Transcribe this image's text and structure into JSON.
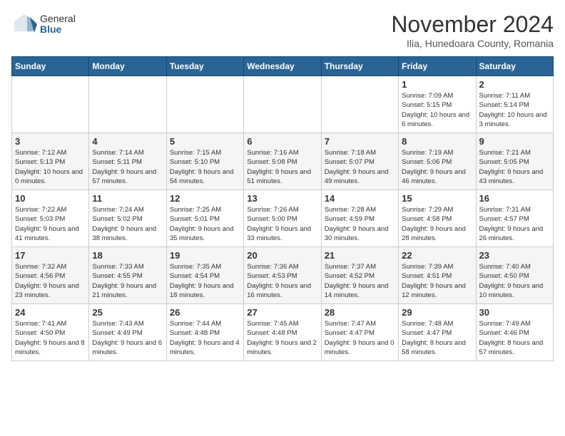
{
  "logo": {
    "general": "General",
    "blue": "Blue"
  },
  "title": "November 2024",
  "subtitle": "Ilia, Hunedoara County, Romania",
  "headers": [
    "Sunday",
    "Monday",
    "Tuesday",
    "Wednesday",
    "Thursday",
    "Friday",
    "Saturday"
  ],
  "weeks": [
    [
      {
        "day": "",
        "info": ""
      },
      {
        "day": "",
        "info": ""
      },
      {
        "day": "",
        "info": ""
      },
      {
        "day": "",
        "info": ""
      },
      {
        "day": "",
        "info": ""
      },
      {
        "day": "1",
        "info": "Sunrise: 7:09 AM\nSunset: 5:15 PM\nDaylight: 10 hours and 6 minutes."
      },
      {
        "day": "2",
        "info": "Sunrise: 7:11 AM\nSunset: 5:14 PM\nDaylight: 10 hours and 3 minutes."
      }
    ],
    [
      {
        "day": "3",
        "info": "Sunrise: 7:12 AM\nSunset: 5:13 PM\nDaylight: 10 hours and 0 minutes."
      },
      {
        "day": "4",
        "info": "Sunrise: 7:14 AM\nSunset: 5:11 PM\nDaylight: 9 hours and 57 minutes."
      },
      {
        "day": "5",
        "info": "Sunrise: 7:15 AM\nSunset: 5:10 PM\nDaylight: 9 hours and 54 minutes."
      },
      {
        "day": "6",
        "info": "Sunrise: 7:16 AM\nSunset: 5:08 PM\nDaylight: 9 hours and 51 minutes."
      },
      {
        "day": "7",
        "info": "Sunrise: 7:18 AM\nSunset: 5:07 PM\nDaylight: 9 hours and 49 minutes."
      },
      {
        "day": "8",
        "info": "Sunrise: 7:19 AM\nSunset: 5:06 PM\nDaylight: 9 hours and 46 minutes."
      },
      {
        "day": "9",
        "info": "Sunrise: 7:21 AM\nSunset: 5:05 PM\nDaylight: 9 hours and 43 minutes."
      }
    ],
    [
      {
        "day": "10",
        "info": "Sunrise: 7:22 AM\nSunset: 5:03 PM\nDaylight: 9 hours and 41 minutes."
      },
      {
        "day": "11",
        "info": "Sunrise: 7:24 AM\nSunset: 5:02 PM\nDaylight: 9 hours and 38 minutes."
      },
      {
        "day": "12",
        "info": "Sunrise: 7:25 AM\nSunset: 5:01 PM\nDaylight: 9 hours and 35 minutes."
      },
      {
        "day": "13",
        "info": "Sunrise: 7:26 AM\nSunset: 5:00 PM\nDaylight: 9 hours and 33 minutes."
      },
      {
        "day": "14",
        "info": "Sunrise: 7:28 AM\nSunset: 4:59 PM\nDaylight: 9 hours and 30 minutes."
      },
      {
        "day": "15",
        "info": "Sunrise: 7:29 AM\nSunset: 4:58 PM\nDaylight: 9 hours and 28 minutes."
      },
      {
        "day": "16",
        "info": "Sunrise: 7:31 AM\nSunset: 4:57 PM\nDaylight: 9 hours and 26 minutes."
      }
    ],
    [
      {
        "day": "17",
        "info": "Sunrise: 7:32 AM\nSunset: 4:56 PM\nDaylight: 9 hours and 23 minutes."
      },
      {
        "day": "18",
        "info": "Sunrise: 7:33 AM\nSunset: 4:55 PM\nDaylight: 9 hours and 21 minutes."
      },
      {
        "day": "19",
        "info": "Sunrise: 7:35 AM\nSunset: 4:54 PM\nDaylight: 9 hours and 18 minutes."
      },
      {
        "day": "20",
        "info": "Sunrise: 7:36 AM\nSunset: 4:53 PM\nDaylight: 9 hours and 16 minutes."
      },
      {
        "day": "21",
        "info": "Sunrise: 7:37 AM\nSunset: 4:52 PM\nDaylight: 9 hours and 14 minutes."
      },
      {
        "day": "22",
        "info": "Sunrise: 7:39 AM\nSunset: 4:51 PM\nDaylight: 9 hours and 12 minutes."
      },
      {
        "day": "23",
        "info": "Sunrise: 7:40 AM\nSunset: 4:50 PM\nDaylight: 9 hours and 10 minutes."
      }
    ],
    [
      {
        "day": "24",
        "info": "Sunrise: 7:41 AM\nSunset: 4:50 PM\nDaylight: 9 hours and 8 minutes."
      },
      {
        "day": "25",
        "info": "Sunrise: 7:43 AM\nSunset: 4:49 PM\nDaylight: 9 hours and 6 minutes."
      },
      {
        "day": "26",
        "info": "Sunrise: 7:44 AM\nSunset: 4:48 PM\nDaylight: 9 hours and 4 minutes."
      },
      {
        "day": "27",
        "info": "Sunrise: 7:45 AM\nSunset: 4:48 PM\nDaylight: 9 hours and 2 minutes."
      },
      {
        "day": "28",
        "info": "Sunrise: 7:47 AM\nSunset: 4:47 PM\nDaylight: 9 hours and 0 minutes."
      },
      {
        "day": "29",
        "info": "Sunrise: 7:48 AM\nSunset: 4:47 PM\nDaylight: 8 hours and 58 minutes."
      },
      {
        "day": "30",
        "info": "Sunrise: 7:49 AM\nSunset: 4:46 PM\nDaylight: 8 hours and 57 minutes."
      }
    ]
  ]
}
